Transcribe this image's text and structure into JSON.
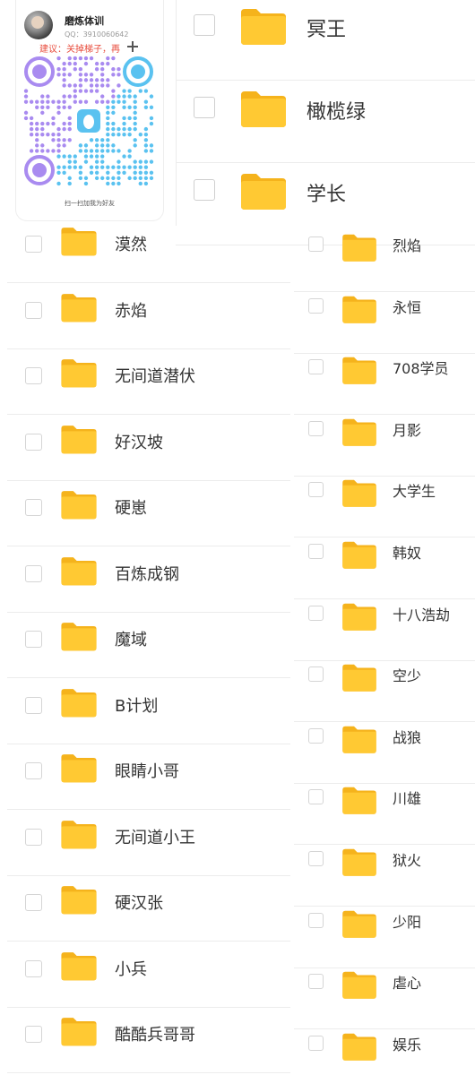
{
  "qr_card": {
    "name": "磨炼体训",
    "qq": "QQ：3910060642",
    "advice": "建议：关掉梯子，再",
    "caption": "扫一扫加我为好友"
  },
  "top_folders": [
    {
      "label": "冥王"
    },
    {
      "label": "橄榄绿"
    },
    {
      "label": "学长"
    }
  ],
  "left_folders": [
    {
      "label": "漠然"
    },
    {
      "label": "赤焰"
    },
    {
      "label": "无间道潜伏"
    },
    {
      "label": "好汉坡"
    },
    {
      "label": "硬崽"
    },
    {
      "label": "百炼成钢"
    },
    {
      "label": "魔域"
    },
    {
      "label": "B计划"
    },
    {
      "label": "眼睛小哥"
    },
    {
      "label": "无间道小王"
    },
    {
      "label": "硬汉张"
    },
    {
      "label": "小兵"
    },
    {
      "label": "酷酷兵哥哥"
    }
  ],
  "right_folders": [
    {
      "label": "烈焰"
    },
    {
      "label": "永恒"
    },
    {
      "label": "708学员"
    },
    {
      "label": "月影"
    },
    {
      "label": "大学生"
    },
    {
      "label": "韩奴"
    },
    {
      "label": "十八浩劫"
    },
    {
      "label": "空少"
    },
    {
      "label": "战狼"
    },
    {
      "label": "川雄"
    },
    {
      "label": "狱火"
    },
    {
      "label": "少阳"
    },
    {
      "label": "虐心"
    },
    {
      "label": "娱乐"
    }
  ],
  "colors": {
    "folder_body": "#ffc933",
    "folder_back": "#f5b31c",
    "qr_purple": "#a98bf0",
    "qr_blue": "#5ac2f0",
    "advice_red": "#e84c3d"
  },
  "icons": {
    "folder": "folder-icon",
    "checkbox": "checkbox-icon",
    "plus": "plus-icon",
    "qr": "qr-code-icon",
    "penguin": "qq-penguin-icon"
  }
}
